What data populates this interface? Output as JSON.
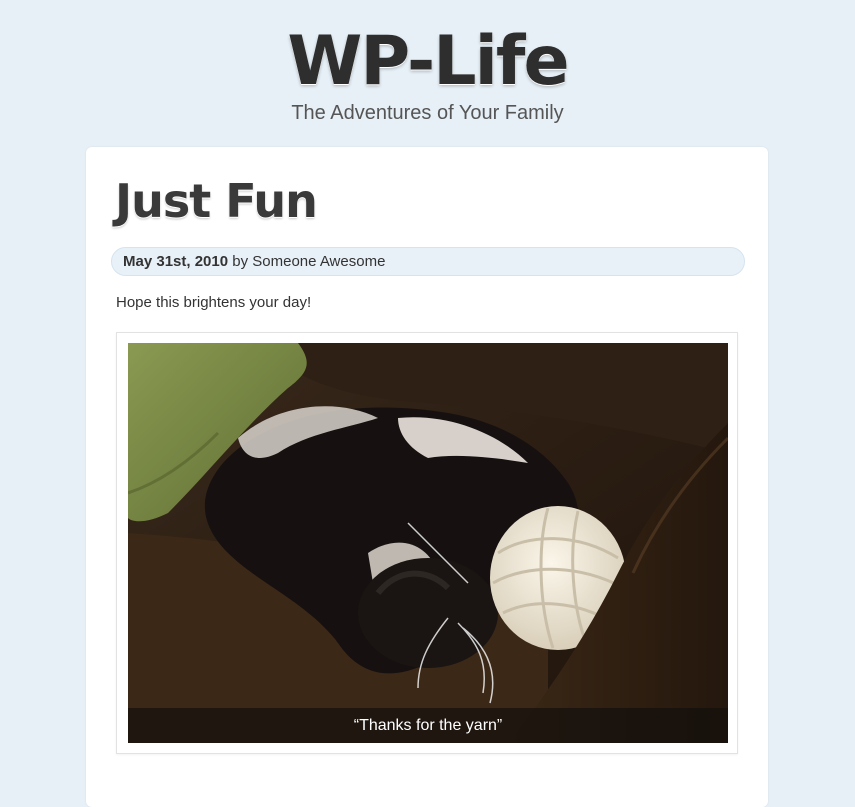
{
  "site": {
    "title": "WP-Life",
    "tagline": "The Adventures of Your Family"
  },
  "post": {
    "title": "Just Fun",
    "date": "May 31st, 2010",
    "by_label": "by",
    "author": "Someone Awesome",
    "body": "Hope this brightens your day!",
    "image_caption": "“Thanks for the yarn”"
  },
  "colors": {
    "page_background": "#e7f0f7",
    "meta_bar": "#e9f1f8",
    "title_text": "#2e2e2e"
  }
}
